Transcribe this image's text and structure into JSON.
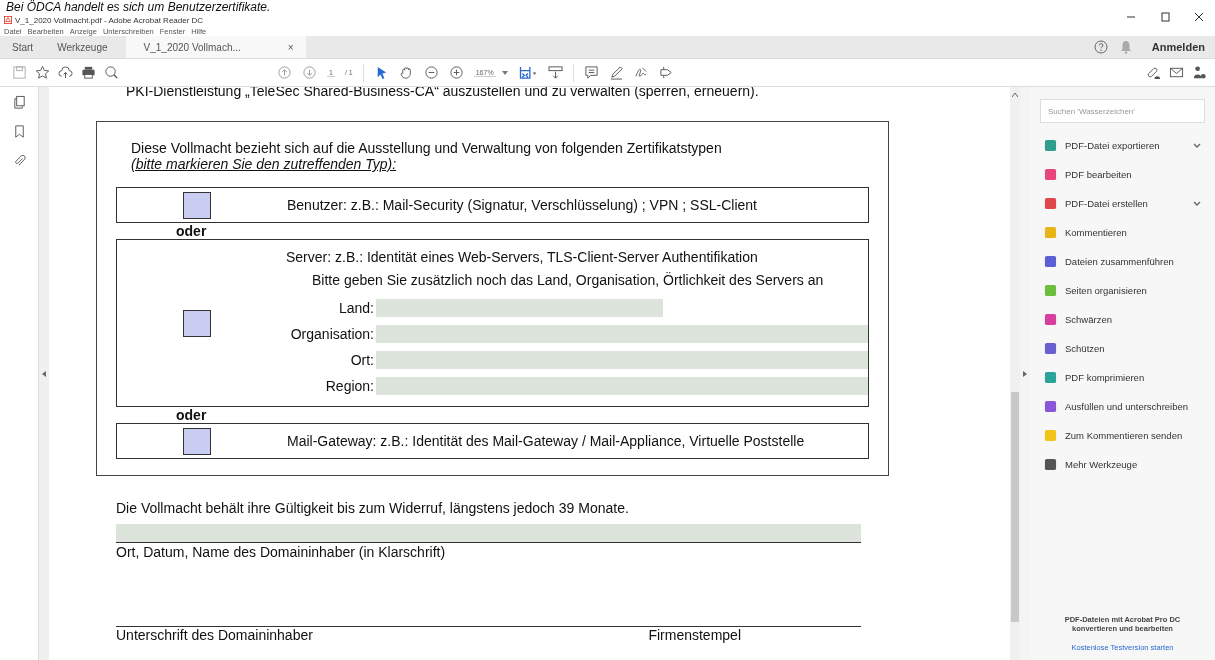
{
  "caption": "Bei ÖDCA handelt es sich um Benutzerzertifikate.",
  "window": {
    "title": "V_1_2020 Vollmacht.pdf - Adobe Acrobat Reader DC"
  },
  "menu": [
    "Datei",
    "Bearbeiten",
    "Anzeige",
    "Unterschreiben",
    "Fenster",
    "Hilfe"
  ],
  "tabs": [
    {
      "label": "Start",
      "selected": false,
      "closable": false
    },
    {
      "label": "Werkzeuge",
      "selected": false,
      "closable": false
    },
    {
      "label": "V_1_2020 Vollmach...",
      "selected": true,
      "closable": true
    }
  ],
  "tab_close": "×",
  "sign_in": "Anmelden",
  "toolbar": {
    "page": "1",
    "page_total": "/ 1",
    "zoom": "167%"
  },
  "document": {
    "top_line": "PKI-Dienstleistung „TeleSec Shared-Business-CA“ auszustellen und zu verwalten (sperren, erneuern).",
    "intro": "Diese Vollmacht bezieht sich auf die Ausstellung und Verwaltung von folgenden Zertifikatstypen",
    "intro_hint": "(bitte markieren Sie den zutreffenden Typ):",
    "options": [
      {
        "checked": false,
        "lines": [
          "Benutzer: z.B.: Mail-Security (Signatur, Verschlüsselung) ; VPN ; SSL-Client"
        ]
      },
      {
        "checked": false,
        "lines": [
          "Server: z.B.: Identität eines Web-Servers, TLS-Client-Server Authentifikation",
          "Bitte geben Sie zusätzlich noch das Land, Organisation, Örtlichkeit des Servers an"
        ],
        "fields": [
          {
            "label": "Land:",
            "kind": "short"
          },
          {
            "label": "Organisation:",
            "kind": "long"
          },
          {
            "label": "Ort:",
            "kind": "long"
          },
          {
            "label": "Region:",
            "kind": "long"
          }
        ]
      },
      {
        "checked": false,
        "lines": [
          "Mail-Gateway: z.B.: Identität des Mail-Gateway / Mail-Appliance, Virtuelle Poststelle"
        ]
      }
    ],
    "separator": [
      "oder",
      "oder"
    ],
    "validity": "Die Vollmacht behält ihre Gültigkeit bis zum Widerruf, längstens jedoch 39 Monate.",
    "name_label": "Ort, Datum, Name des Domaininhaber (in Klarschrift)",
    "signature_label": "Unterschrift des Domaininhaber",
    "stamp_label": "Firmenstempel"
  },
  "tools_panel": {
    "search_placeholder": "Suchen 'Wasserzeichen'",
    "tools": [
      {
        "label": "PDF-Datei exportieren",
        "color": "#2f9e8f",
        "expandable": true
      },
      {
        "label": "PDF bearbeiten",
        "color": "#e8457c",
        "expandable": false
      },
      {
        "label": "PDF-Datei erstellen",
        "color": "#e0464b",
        "expandable": true
      },
      {
        "label": "Kommentieren",
        "color": "#e8b417",
        "expandable": false
      },
      {
        "label": "Dateien zusammenführen",
        "color": "#5b5fd6",
        "expandable": false
      },
      {
        "label": "Seiten organisieren",
        "color": "#6bbf3c",
        "expandable": false
      },
      {
        "label": "Schwärzen",
        "color": "#d63f9e",
        "expandable": false
      },
      {
        "label": "Schützen",
        "color": "#6a5fd0",
        "expandable": false
      },
      {
        "label": "PDF komprimieren",
        "color": "#2aa39a",
        "expandable": false
      },
      {
        "label": "Ausfüllen und unterschreiben",
        "color": "#8a58d6",
        "expandable": false
      },
      {
        "label": "Zum Kommentieren senden",
        "color": "#f0c419",
        "expandable": false
      },
      {
        "label": "Mehr Werkzeuge",
        "color": "#555555",
        "expandable": false
      }
    ],
    "promo": "PDF-Dateien mit Acrobat Pro DC konvertieren und bearbeiten",
    "trial_link": "Kostenlose Testversion starten"
  }
}
